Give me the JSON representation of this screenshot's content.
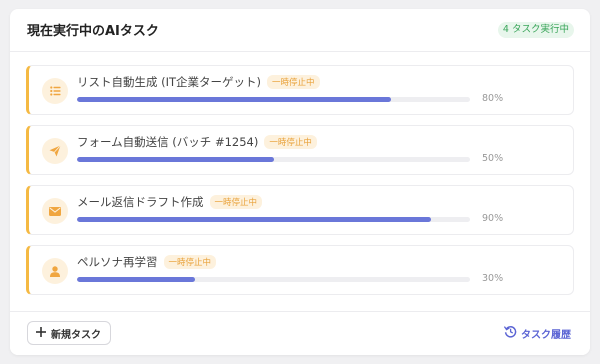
{
  "header": {
    "title": "現在実行中のAIタスク",
    "badge": "4 タスク実行中"
  },
  "tasks": [
    {
      "icon": "list-icon",
      "name": "リスト自動生成 (IT企業ターゲット)",
      "status": "一時停止中",
      "progress": 80,
      "progress_label": "80%"
    },
    {
      "icon": "send-icon",
      "name": "フォーム自動送信 (バッチ #1254)",
      "status": "一時停止中",
      "progress": 50,
      "progress_label": "50%"
    },
    {
      "icon": "mail-icon",
      "name": "メール返信ドラフト作成",
      "status": "一時停止中",
      "progress": 90,
      "progress_label": "90%"
    },
    {
      "icon": "user-icon",
      "name": "ペルソナ再学習",
      "status": "一時停止中",
      "progress": 30,
      "progress_label": "30%"
    }
  ],
  "footer": {
    "new_task_label": "新規タスク",
    "history_label": "タスク履歴"
  },
  "colors": {
    "accent": "#6a77d9",
    "paused": "#e9a23b",
    "running": "#3aa55a"
  }
}
